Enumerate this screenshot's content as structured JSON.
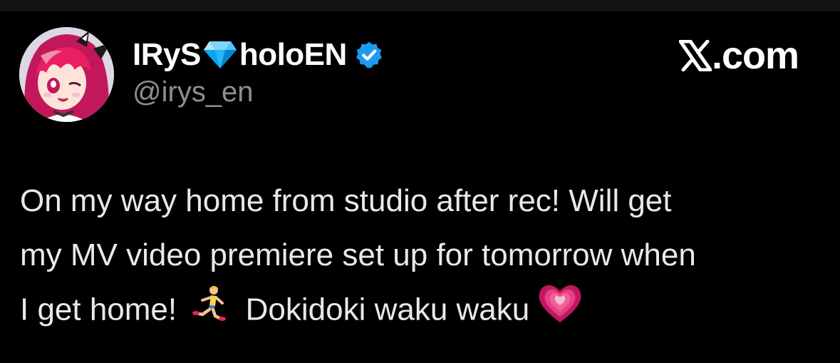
{
  "author": {
    "name_part1": "IRyS",
    "name_part2": "holoEN",
    "handle": "@irys_en",
    "verified": true,
    "avatar": "avatar-image"
  },
  "brand": {
    "label": ".com",
    "icon": "x-logo-icon"
  },
  "tweet": {
    "line1": "On my way home from studio after rec! Will get",
    "line2": "my MV video premiere set up for tomorrow when",
    "line3a": "I get home!",
    "line3b": "Dokidoki waku waku",
    "emojis": [
      "running-woman-emoji",
      "growing-heart-emoji"
    ]
  },
  "colors": {
    "background": "#000000",
    "text": "#e7e9ea",
    "handle": "#8b9096",
    "verified_blue": "#1d9bf0",
    "diamond": "#4fc3f7",
    "heart": "#e83e8c"
  }
}
